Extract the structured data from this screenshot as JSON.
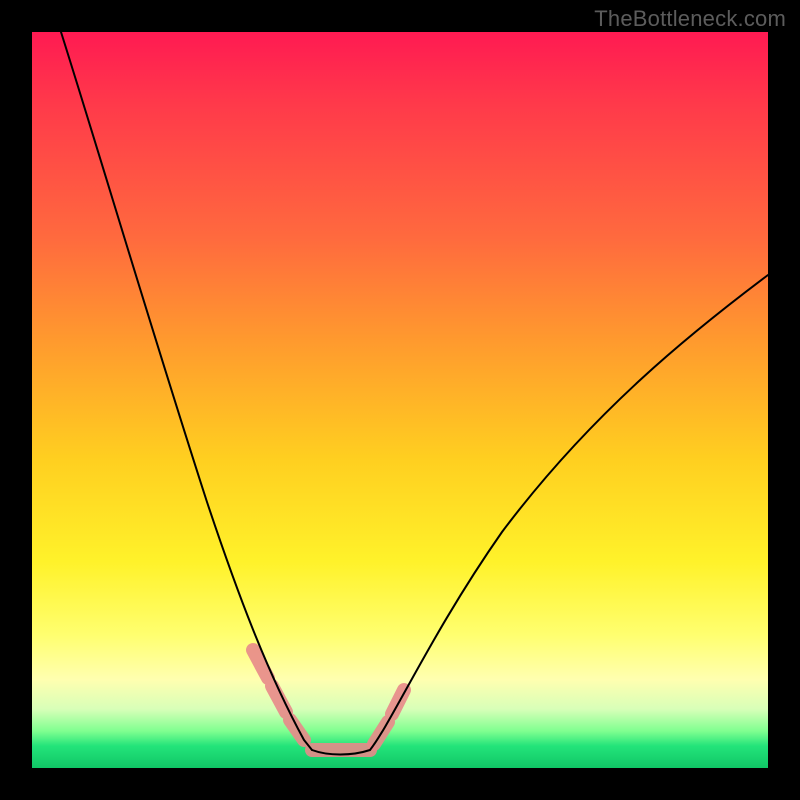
{
  "watermark": {
    "text": "TheBottleneck.com"
  },
  "colors": {
    "frame": "#000000",
    "gradient_top": "#ff1a52",
    "gradient_mid": "#fff22a",
    "gradient_bottom": "#10c666",
    "curve_stroke": "#000000",
    "haze_stroke": "#e88a8a"
  },
  "chart_data": {
    "type": "line",
    "title": "",
    "xlabel": "",
    "ylabel": "",
    "xlim": [
      0,
      100
    ],
    "ylim": [
      0,
      100
    ],
    "grid": false,
    "legend": false,
    "series": [
      {
        "name": "left-curve",
        "x": [
          4,
          8,
          12,
          16,
          20,
          24,
          28,
          31,
          33,
          34,
          35,
          36,
          37,
          38
        ],
        "y": [
          100,
          84,
          68,
          54,
          42,
          31,
          21,
          13,
          9,
          7,
          5.5,
          4,
          3,
          2.4
        ]
      },
      {
        "name": "valley-floor",
        "x": [
          38,
          40,
          42,
          44,
          46
        ],
        "y": [
          2.4,
          2.0,
          2.0,
          2.0,
          2.4
        ]
      },
      {
        "name": "right-curve",
        "x": [
          46,
          48,
          50,
          54,
          60,
          68,
          76,
          84,
          92,
          100
        ],
        "y": [
          2.4,
          4,
          6,
          11,
          20,
          32,
          43,
          52,
          60,
          67
        ]
      }
    ],
    "highlight_segments": [
      {
        "name": "haze-left",
        "x": [
          30,
          38
        ],
        "y": [
          16,
          2.4
        ]
      },
      {
        "name": "haze-floor",
        "x": [
          38,
          46
        ],
        "y": [
          2.4,
          2.4
        ]
      },
      {
        "name": "haze-right",
        "x": [
          46,
          50
        ],
        "y": [
          2.4,
          8
        ]
      }
    ]
  }
}
